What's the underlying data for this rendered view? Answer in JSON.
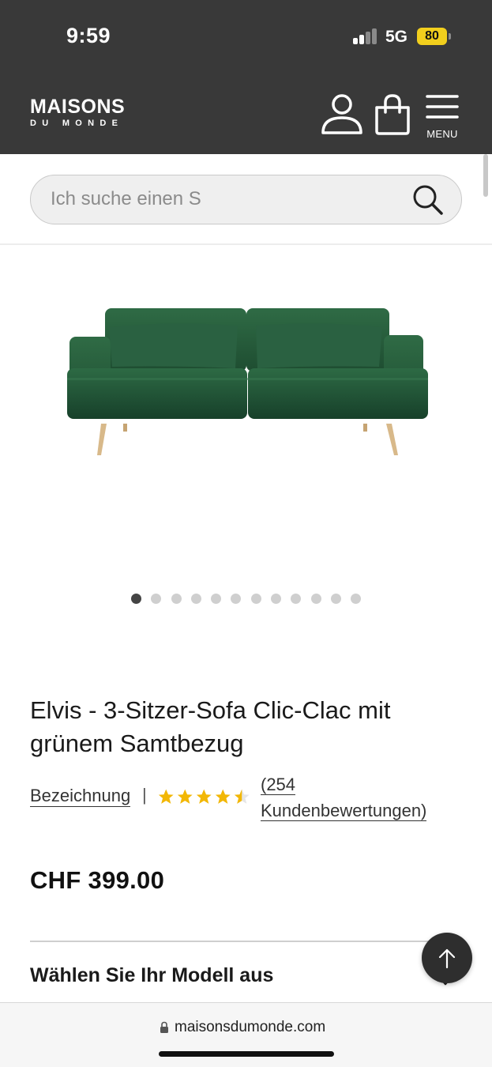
{
  "status_bar": {
    "time": "9:59",
    "network": "5G",
    "battery": "80"
  },
  "header": {
    "logo_line1": "MAISONS",
    "logo_line2": "DU MONDE",
    "account_icon": "user-icon",
    "cart_icon": "shopping-bag-icon",
    "menu_icon": "hamburger-icon",
    "menu_label": "MENU",
    "background_color": "#393939"
  },
  "search": {
    "placeholder": "Ich suche einen S",
    "value": "",
    "icon": "search-icon"
  },
  "gallery": {
    "image_alt": "green velvet 3-seater sofa",
    "image_count": 12,
    "active_index": 0
  },
  "product": {
    "title": "Elvis - 3-Sitzer-Sofa Clic-Clac mit grünem Samtbezug",
    "reference_link": "Bezeichnung",
    "separator": "|",
    "rating": 4.5,
    "rating_max": 5,
    "reviews_line1": "(254",
    "reviews_line2": "Kundenbewertungen)",
    "price": "CHF 399.00",
    "star_color": "#f2b705"
  },
  "options": {
    "model_label": "Wählen Sie Ihr Modell aus"
  },
  "back_to_top": {
    "icon": "arrow-up-icon"
  },
  "browser": {
    "url": "maisonsdumonde.com",
    "lock_icon": "lock-icon"
  }
}
